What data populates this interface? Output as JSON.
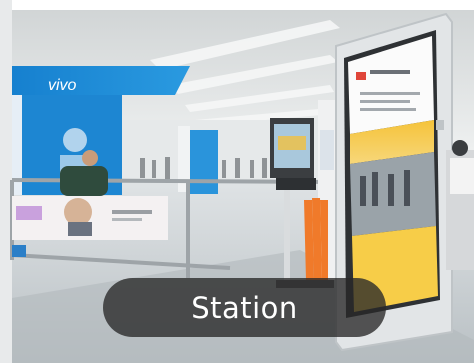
{
  "caption": {
    "text": "Station"
  },
  "brand": {
    "name": "vivo"
  },
  "colors": {
    "ceiling": "#d9dcdd",
    "floor": "#c9cfd2",
    "brand_blue": "#1f8ad6",
    "kiosk_frame": "#e7e9ea",
    "kiosk_screen": "#fbfbfb",
    "screen_accent": "#f2b21c",
    "umbrella": "#f07a2a"
  }
}
